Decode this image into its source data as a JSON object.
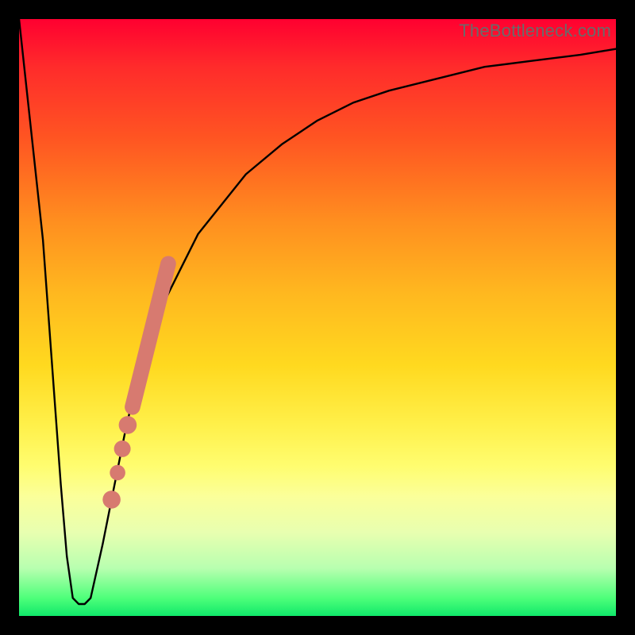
{
  "watermark": "TheBottleneck.com",
  "colors": {
    "background": "#000000",
    "curve_stroke": "#000000",
    "marker_fill": "#d77a70",
    "gradient_top": "#ff0030",
    "gradient_bottom": "#10e86a"
  },
  "chart_data": {
    "type": "line",
    "title": "",
    "xlabel": "",
    "ylabel": "",
    "xlim": [
      0,
      100
    ],
    "ylim": [
      0,
      100
    ],
    "grid": false,
    "legend": false,
    "series": [
      {
        "name": "bottleneck-curve",
        "x": [
          0,
          4,
          7,
          8,
          9,
          10,
          11,
          12,
          14,
          16,
          18,
          20,
          22,
          24,
          27,
          30,
          34,
          38,
          44,
          50,
          56,
          62,
          70,
          78,
          86,
          94,
          100
        ],
        "y": [
          100,
          63,
          22,
          10,
          3,
          2,
          2,
          3,
          12,
          22,
          32,
          40,
          46,
          52,
          58,
          64,
          69,
          74,
          79,
          83,
          86,
          88,
          90,
          92,
          93,
          94,
          95
        ]
      }
    ],
    "markers": [
      {
        "name": "segment",
        "shape": "pill",
        "x_start": 19,
        "y_start": 35,
        "x_end": 25,
        "y_end": 59,
        "width": 2.6
      },
      {
        "name": "dot-1",
        "shape": "circle",
        "x": 18.2,
        "y": 32.0,
        "r": 1.5
      },
      {
        "name": "dot-2",
        "shape": "circle",
        "x": 17.3,
        "y": 28.0,
        "r": 1.4
      },
      {
        "name": "dot-3",
        "shape": "circle",
        "x": 16.5,
        "y": 24.0,
        "r": 1.3
      },
      {
        "name": "dot-4",
        "shape": "circle",
        "x": 15.5,
        "y": 19.5,
        "r": 1.5
      }
    ]
  }
}
